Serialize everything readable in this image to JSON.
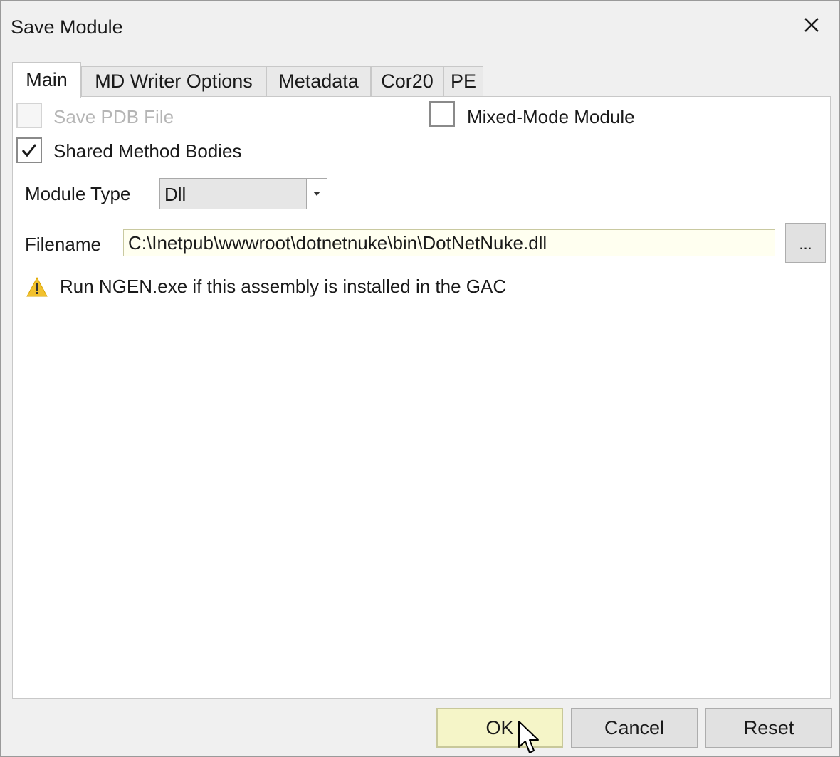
{
  "window": {
    "title": "Save Module"
  },
  "tabs": [
    {
      "label": "Main",
      "active": true
    },
    {
      "label": "MD Writer Options",
      "active": false
    },
    {
      "label": "Metadata",
      "active": false
    },
    {
      "label": "Cor20",
      "active": false
    },
    {
      "label": "PE",
      "active": false
    }
  ],
  "main": {
    "save_pdb": {
      "label": "Save PDB File",
      "checked": false,
      "enabled": false
    },
    "mixed_mode": {
      "label": "Mixed-Mode Module",
      "checked": false,
      "enabled": true
    },
    "shared_method_bodies": {
      "label": "Shared Method Bodies",
      "checked": true,
      "enabled": true
    },
    "module_type": {
      "label": "Module Type",
      "value": "Dll"
    },
    "filename": {
      "label": "Filename",
      "value": "C:\\Inetpub\\wwwroot\\dotnetnuke\\bin\\DotNetNuke.dll",
      "browse_label": "..."
    },
    "warning": {
      "text": "Run NGEN.exe if this assembly is installed in the GAC"
    }
  },
  "buttons": {
    "ok": "OK",
    "cancel": "Cancel",
    "reset": "Reset"
  },
  "colors": {
    "default_button": "#f5f5c8",
    "filename_bg": "#fffff0",
    "warning_icon": "#f2c12e"
  }
}
